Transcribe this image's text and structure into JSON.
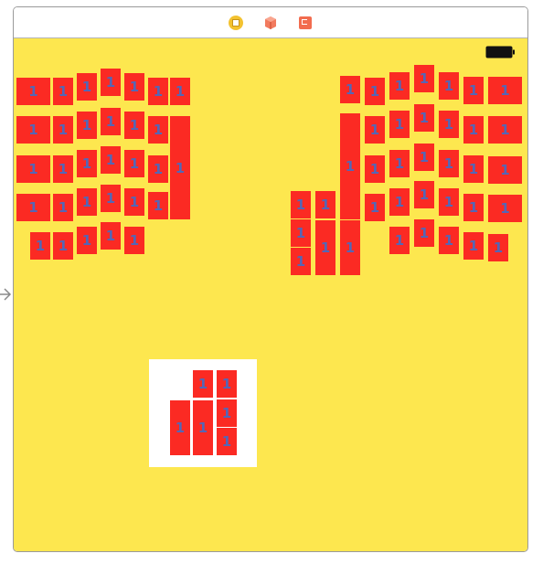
{
  "editor": {
    "dock_icons": [
      "view-controller-icon",
      "first-responder-icon",
      "exit-icon"
    ],
    "entry_point_icon": "storyboard-entry-arrow-icon"
  },
  "device": {
    "battery_icon": "battery-icon"
  },
  "colors": {
    "background": "#fde74f",
    "tile": "#fb2a23",
    "tile_label": "#5466b6",
    "inner_box": "#ffffff"
  },
  "tile_label": "1"
}
